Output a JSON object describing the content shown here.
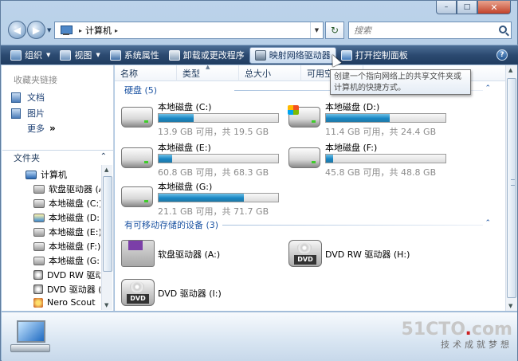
{
  "caption": {
    "minimize": "–",
    "maximize": "□",
    "close": "✕"
  },
  "address": {
    "path": [
      "计算机"
    ],
    "separator": "▸"
  },
  "search": {
    "placeholder": "搜索"
  },
  "toolbar": {
    "items": [
      {
        "label": "组织",
        "icon": "organize-icon",
        "dropdown": true
      },
      {
        "label": "视图",
        "icon": "views-icon",
        "dropdown": true
      },
      {
        "label": "系统属性",
        "icon": "system-properties-icon"
      },
      {
        "label": "卸载或更改程序",
        "icon": "uninstall-icon"
      },
      {
        "label": "映射网络驱动器",
        "icon": "map-drive-icon",
        "active": true
      },
      {
        "label": "打开控制面板",
        "icon": "control-panel-icon"
      }
    ]
  },
  "nav_pane": {
    "favorites_title": "收藏夹链接",
    "favorites": [
      {
        "label": "文档",
        "icon": "documents-icon"
      },
      {
        "label": "图片",
        "icon": "pictures-icon"
      }
    ],
    "more_label": "更多",
    "more_glyph": "»",
    "folders_title": "文件夹",
    "tree": [
      {
        "label": "计算机",
        "icon": "computer-icon"
      },
      {
        "label": "软盘驱动器 (A:)",
        "icon": "floppy-icon"
      },
      {
        "label": "本地磁盘 (C:)",
        "icon": "drive-icon"
      },
      {
        "label": "本地磁盘 (D:)",
        "icon": "os-drive-icon"
      },
      {
        "label": "本地磁盘 (E:)",
        "icon": "drive-icon"
      },
      {
        "label": "本地磁盘 (F:)",
        "icon": "drive-icon"
      },
      {
        "label": "本地磁盘 (G:)",
        "icon": "drive-icon"
      },
      {
        "label": "DVD RW 驱动器 (H:)",
        "icon": "dvd-icon"
      },
      {
        "label": "DVD 驱动器 (I:)",
        "icon": "dvd-icon"
      },
      {
        "label": "Nero Scout",
        "icon": "nero-icon"
      }
    ]
  },
  "columns": [
    "名称",
    "类型",
    "总大小",
    "可用空间"
  ],
  "groups": {
    "hdd_title": "硬盘 (5)",
    "removable_title": "有可移动存储的设备 (3)"
  },
  "drives": [
    {
      "name": "本地磁盘 (C:)",
      "size": "13.9 GB 可用，共 19.5 GB",
      "used_pct": 29
    },
    {
      "name": "本地磁盘 (D:)",
      "size": "11.4 GB 可用，共 24.4 GB",
      "used_pct": 53
    },
    {
      "name": "本地磁盘 (E:)",
      "size": "60.8 GB 可用，共 68.3 GB",
      "used_pct": 11
    },
    {
      "name": "本地磁盘 (F:)",
      "size": "45.8 GB 可用，共 48.8 GB",
      "used_pct": 6
    },
    {
      "name": "本地磁盘 (G:)",
      "size": "21.1 GB 可用，共 71.7 GB",
      "used_pct": 71
    }
  ],
  "removable": [
    {
      "name": "软盘驱动器 (A:)",
      "icon": "floppy-drive-icon"
    },
    {
      "name": "DVD RW 驱动器 (H:)",
      "icon": "dvd-rw-drive-icon"
    },
    {
      "name": "DVD 驱动器 (I:)",
      "icon": "dvd-drive-icon"
    }
  ],
  "tooltip": {
    "line1": "创建一个指向网络上的共享文件夹或",
    "line2": "计算机的快捷方式。"
  },
  "watermark": {
    "logo_main": "51CTO",
    "logo_dot": ".",
    "logo_tld": "com",
    "sub": "技术成就梦想"
  }
}
